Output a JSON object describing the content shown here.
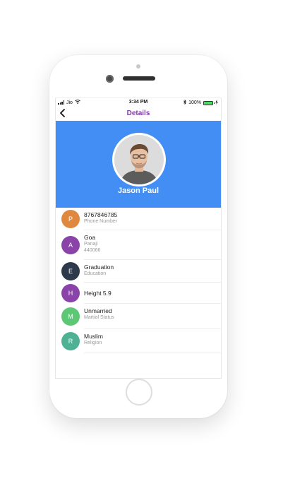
{
  "status_bar": {
    "carrier": "Jio",
    "time": "3:34 PM",
    "battery_percent": "100%",
    "battery_level": 1.0,
    "icons": [
      "signal-icon",
      "wifi-icon",
      "bluetooth-icon",
      "battery-icon",
      "charging-icon"
    ]
  },
  "nav": {
    "title": "Details",
    "back_icon": "chevron-left-icon"
  },
  "profile": {
    "name": "Jason Paul",
    "header_color": "#428ef5"
  },
  "details": [
    {
      "letter": "P",
      "color": "#e0893e",
      "primary": "8767846785",
      "secondary": "Phone Number",
      "tertiary": ""
    },
    {
      "letter": "A",
      "color": "#8a43a8",
      "primary": "Goa",
      "secondary": "Panaji",
      "tertiary": "440066"
    },
    {
      "letter": "E",
      "color": "#2d3a4b",
      "primary": "Graduation",
      "secondary": "Education",
      "tertiary": ""
    },
    {
      "letter": "H",
      "color": "#8a43a8",
      "primary": "Height  5.9",
      "secondary": "",
      "tertiary": ""
    },
    {
      "letter": "M",
      "color": "#5cc775",
      "primary": "Unmarried",
      "secondary": "Martial Status",
      "tertiary": ""
    },
    {
      "letter": "R",
      "color": "#4fb194",
      "primary": "Muslim",
      "secondary": "Religion",
      "tertiary": ""
    }
  ],
  "colors": {
    "title": "#7d3aa8",
    "accent": "#428ef5"
  }
}
